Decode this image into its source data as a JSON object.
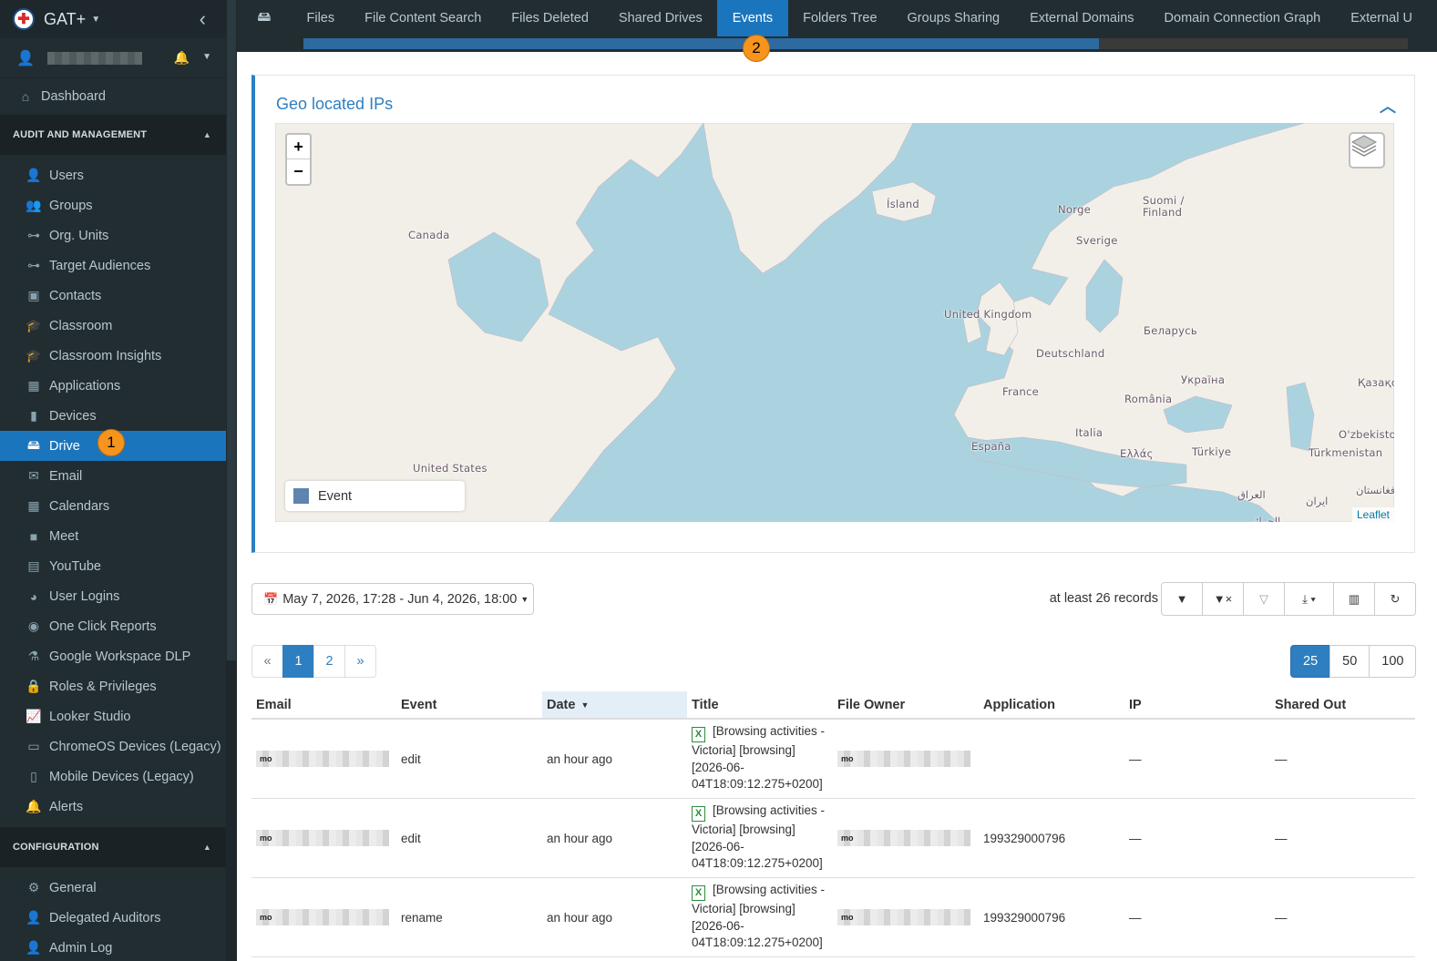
{
  "app": {
    "name": "GAT+"
  },
  "sidebar": {
    "dashboard": "Dashboard",
    "audit_section": "AUDIT AND MANAGEMENT",
    "audit_items": [
      {
        "label": "Users",
        "icon": "user-icon"
      },
      {
        "label": "Groups",
        "icon": "groups-icon"
      },
      {
        "label": "Org. Units",
        "icon": "sitemap-icon"
      },
      {
        "label": "Target Audiences",
        "icon": "sitemap-icon"
      },
      {
        "label": "Contacts",
        "icon": "contact-card-icon"
      },
      {
        "label": "Classroom",
        "icon": "graduation-cap-icon"
      },
      {
        "label": "Classroom Insights",
        "icon": "graduation-search-icon"
      },
      {
        "label": "Applications",
        "icon": "grid-icon"
      },
      {
        "label": "Devices",
        "icon": "device-icon"
      },
      {
        "label": "Drive",
        "icon": "hdd-icon",
        "active": true,
        "badge": "1"
      },
      {
        "label": "Email",
        "icon": "envelope-icon"
      },
      {
        "label": "Calendars",
        "icon": "calendar-icon"
      },
      {
        "label": "Meet",
        "icon": "video-camera-icon"
      },
      {
        "label": "YouTube",
        "icon": "film-icon"
      },
      {
        "label": "User Logins",
        "icon": "globe-icon"
      },
      {
        "label": "One Click Reports",
        "icon": "eye-icon"
      },
      {
        "label": "Google Workspace DLP",
        "icon": "flask-icon"
      },
      {
        "label": "Roles & Privileges",
        "icon": "lock-icon"
      },
      {
        "label": "Looker Studio",
        "icon": "line-chart-icon"
      },
      {
        "label": "ChromeOS Devices (Legacy)",
        "icon": "laptop-icon"
      },
      {
        "label": "Mobile Devices (Legacy)",
        "icon": "mobile-icon"
      },
      {
        "label": "Alerts",
        "icon": "bell-icon"
      }
    ],
    "config_section": "CONFIGURATION",
    "config_items": [
      {
        "label": "General",
        "icon": "cogs-icon"
      },
      {
        "label": "Delegated Auditors",
        "icon": "user-cog-icon"
      },
      {
        "label": "Admin Log",
        "icon": "user-cog-icon"
      }
    ]
  },
  "tabs": [
    {
      "label": "Files"
    },
    {
      "label": "File Content Search"
    },
    {
      "label": "Files Deleted"
    },
    {
      "label": "Shared Drives"
    },
    {
      "label": "Events",
      "active": true,
      "badge": "2"
    },
    {
      "label": "Folders Tree"
    },
    {
      "label": "Groups Sharing"
    },
    {
      "label": "External Domains"
    },
    {
      "label": "Domain Connection Graph"
    },
    {
      "label": "External U"
    }
  ],
  "progress": {
    "fraction": 0.72
  },
  "geo": {
    "title": "Geo located IPs",
    "zoom_in": "+",
    "zoom_out": "−",
    "legend_label": "Event",
    "attribution": "Leaflet",
    "labels": [
      "Canada",
      "Ísland",
      "Norge",
      "Suomi /",
      "Finland",
      "Sverige",
      "United Kingdom",
      "Беларусь",
      "Deutschland",
      "Україна",
      "Қазақс",
      "France",
      "România",
      "Italia",
      "O'zbekistor",
      "España",
      "Ελλάς",
      "Türkiye",
      "Türkmenistan",
      "United States",
      "العراق",
      "ایران",
      "افغانستان",
      "الجزائر"
    ]
  },
  "toolbar": {
    "date_range": "May 7, 2026, 17:28 - Jun 4, 2026, 18:00",
    "records": "at least 26 records",
    "buttons": [
      "filter-icon",
      "filter-clear-icon",
      "filter-remove-icon",
      "export-icon",
      "columns-icon",
      "refresh-icon"
    ]
  },
  "pagination": {
    "prev": "«",
    "pages": [
      "1",
      "2"
    ],
    "current": "1",
    "next": "»",
    "page_sizes": [
      "25",
      "50",
      "100"
    ],
    "current_size": "25"
  },
  "table": {
    "columns": [
      "Email",
      "Event",
      "Date",
      "Title",
      "File Owner",
      "Application",
      "IP",
      "Shared Out"
    ],
    "sorted_column": "Date",
    "rows": [
      {
        "email_prefix": "mo",
        "event": "edit",
        "date": "an hour ago",
        "title": "[Browsing activities - Victoria] [browsing] [2026-06-04T18:09:12.275+0200]",
        "owner_prefix": "mo",
        "application": "",
        "ip": "—",
        "shared_out": "—"
      },
      {
        "email_prefix": "mo",
        "event": "edit",
        "date": "an hour ago",
        "title": "[Browsing activities - Victoria] [browsing] [2026-06-04T18:09:12.275+0200]",
        "owner_prefix": "mo",
        "application": "199329000796",
        "ip": "—",
        "shared_out": "—"
      },
      {
        "email_prefix": "mo",
        "event": "rename",
        "date": "an hour ago",
        "title": "[Browsing activities - Victoria] [browsing] [2026-06-04T18:09:12.275+0200]",
        "owner_prefix": "mo",
        "application": "199329000796",
        "ip": "—",
        "shared_out": "—"
      }
    ]
  },
  "colors": {
    "accent": "#1b75bc",
    "sidebar_bg": "#222d32",
    "badge": "#f7941d",
    "sea": "#aad3df",
    "land": "#f2efe9"
  }
}
